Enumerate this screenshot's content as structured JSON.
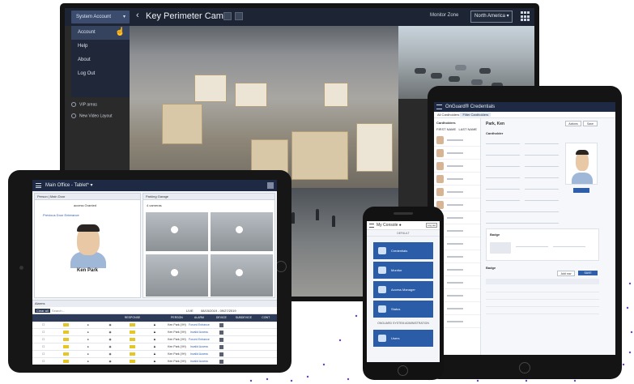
{
  "monitor": {
    "account_button": "System Account",
    "title": "Key Perimeter Cams",
    "zone_label": "Monitor Zone",
    "zone_value": "North America",
    "menu": [
      {
        "label": "Account"
      },
      {
        "label": "Help"
      },
      {
        "label": "About"
      },
      {
        "label": "Log Out"
      }
    ],
    "checks": [
      "VIP areas",
      "New Video Layout"
    ]
  },
  "tablet_left": {
    "title": "Main Office - Tablet* ▾",
    "panel1_tab": "Person | Main Door",
    "panel1_sub": "access Granted",
    "panel1_link": "Previous Door Enterance",
    "person_name": "Ken Park",
    "panel2_tab": "Parking Garage",
    "panel2_sub": "4 cameras",
    "table_tab": "Alarms",
    "clear_all": "Clear all",
    "search": "Search...",
    "live": "LIVE",
    "date_range": "08/15/2019 - 09/27/2019",
    "columns": [
      "",
      "",
      "",
      "",
      "RESPONSE",
      "",
      "PERSON",
      "ALARM",
      "DEVICE",
      "SUBDEVICE",
      "CONT"
    ],
    "rows": [
      {
        "person": "Ken Park (VH)",
        "alarm": "Forced Entrance"
      },
      {
        "person": "Ken Park (VH)",
        "alarm": "Invalid Access"
      },
      {
        "person": "Ken Park (VH)",
        "alarm": "Forced Entrance"
      },
      {
        "person": "Ken Park (VH)",
        "alarm": "Invalid Access"
      },
      {
        "person": "Ken Park (VH)",
        "alarm": "Invalid Access"
      },
      {
        "person": "Ken Park (VH)",
        "alarm": "Invalid Access"
      }
    ]
  },
  "tablet_right": {
    "title": "OnGuard® Credentials",
    "tabs": [
      "All Cardholders",
      "Filter Cardholders"
    ],
    "list_header": "Cardholders",
    "list_cols": [
      "FIRST NAME",
      "LAST NAME"
    ],
    "person_name": "Park, Ken",
    "sections": [
      "Cardholder",
      "Badge",
      "Badge"
    ],
    "add_row": "Add row",
    "save": "SAVE",
    "actions": [
      "Actions",
      "Save"
    ]
  },
  "phone": {
    "title": "My Console",
    "logout": "Log out",
    "subtitle": "DEFAULT",
    "tiles": [
      "Credentials",
      "Monitor",
      "Access Manager",
      "Status"
    ],
    "section": "ONGUARD SYSTEM ADMINISTRATION",
    "last_tile": "Users"
  }
}
